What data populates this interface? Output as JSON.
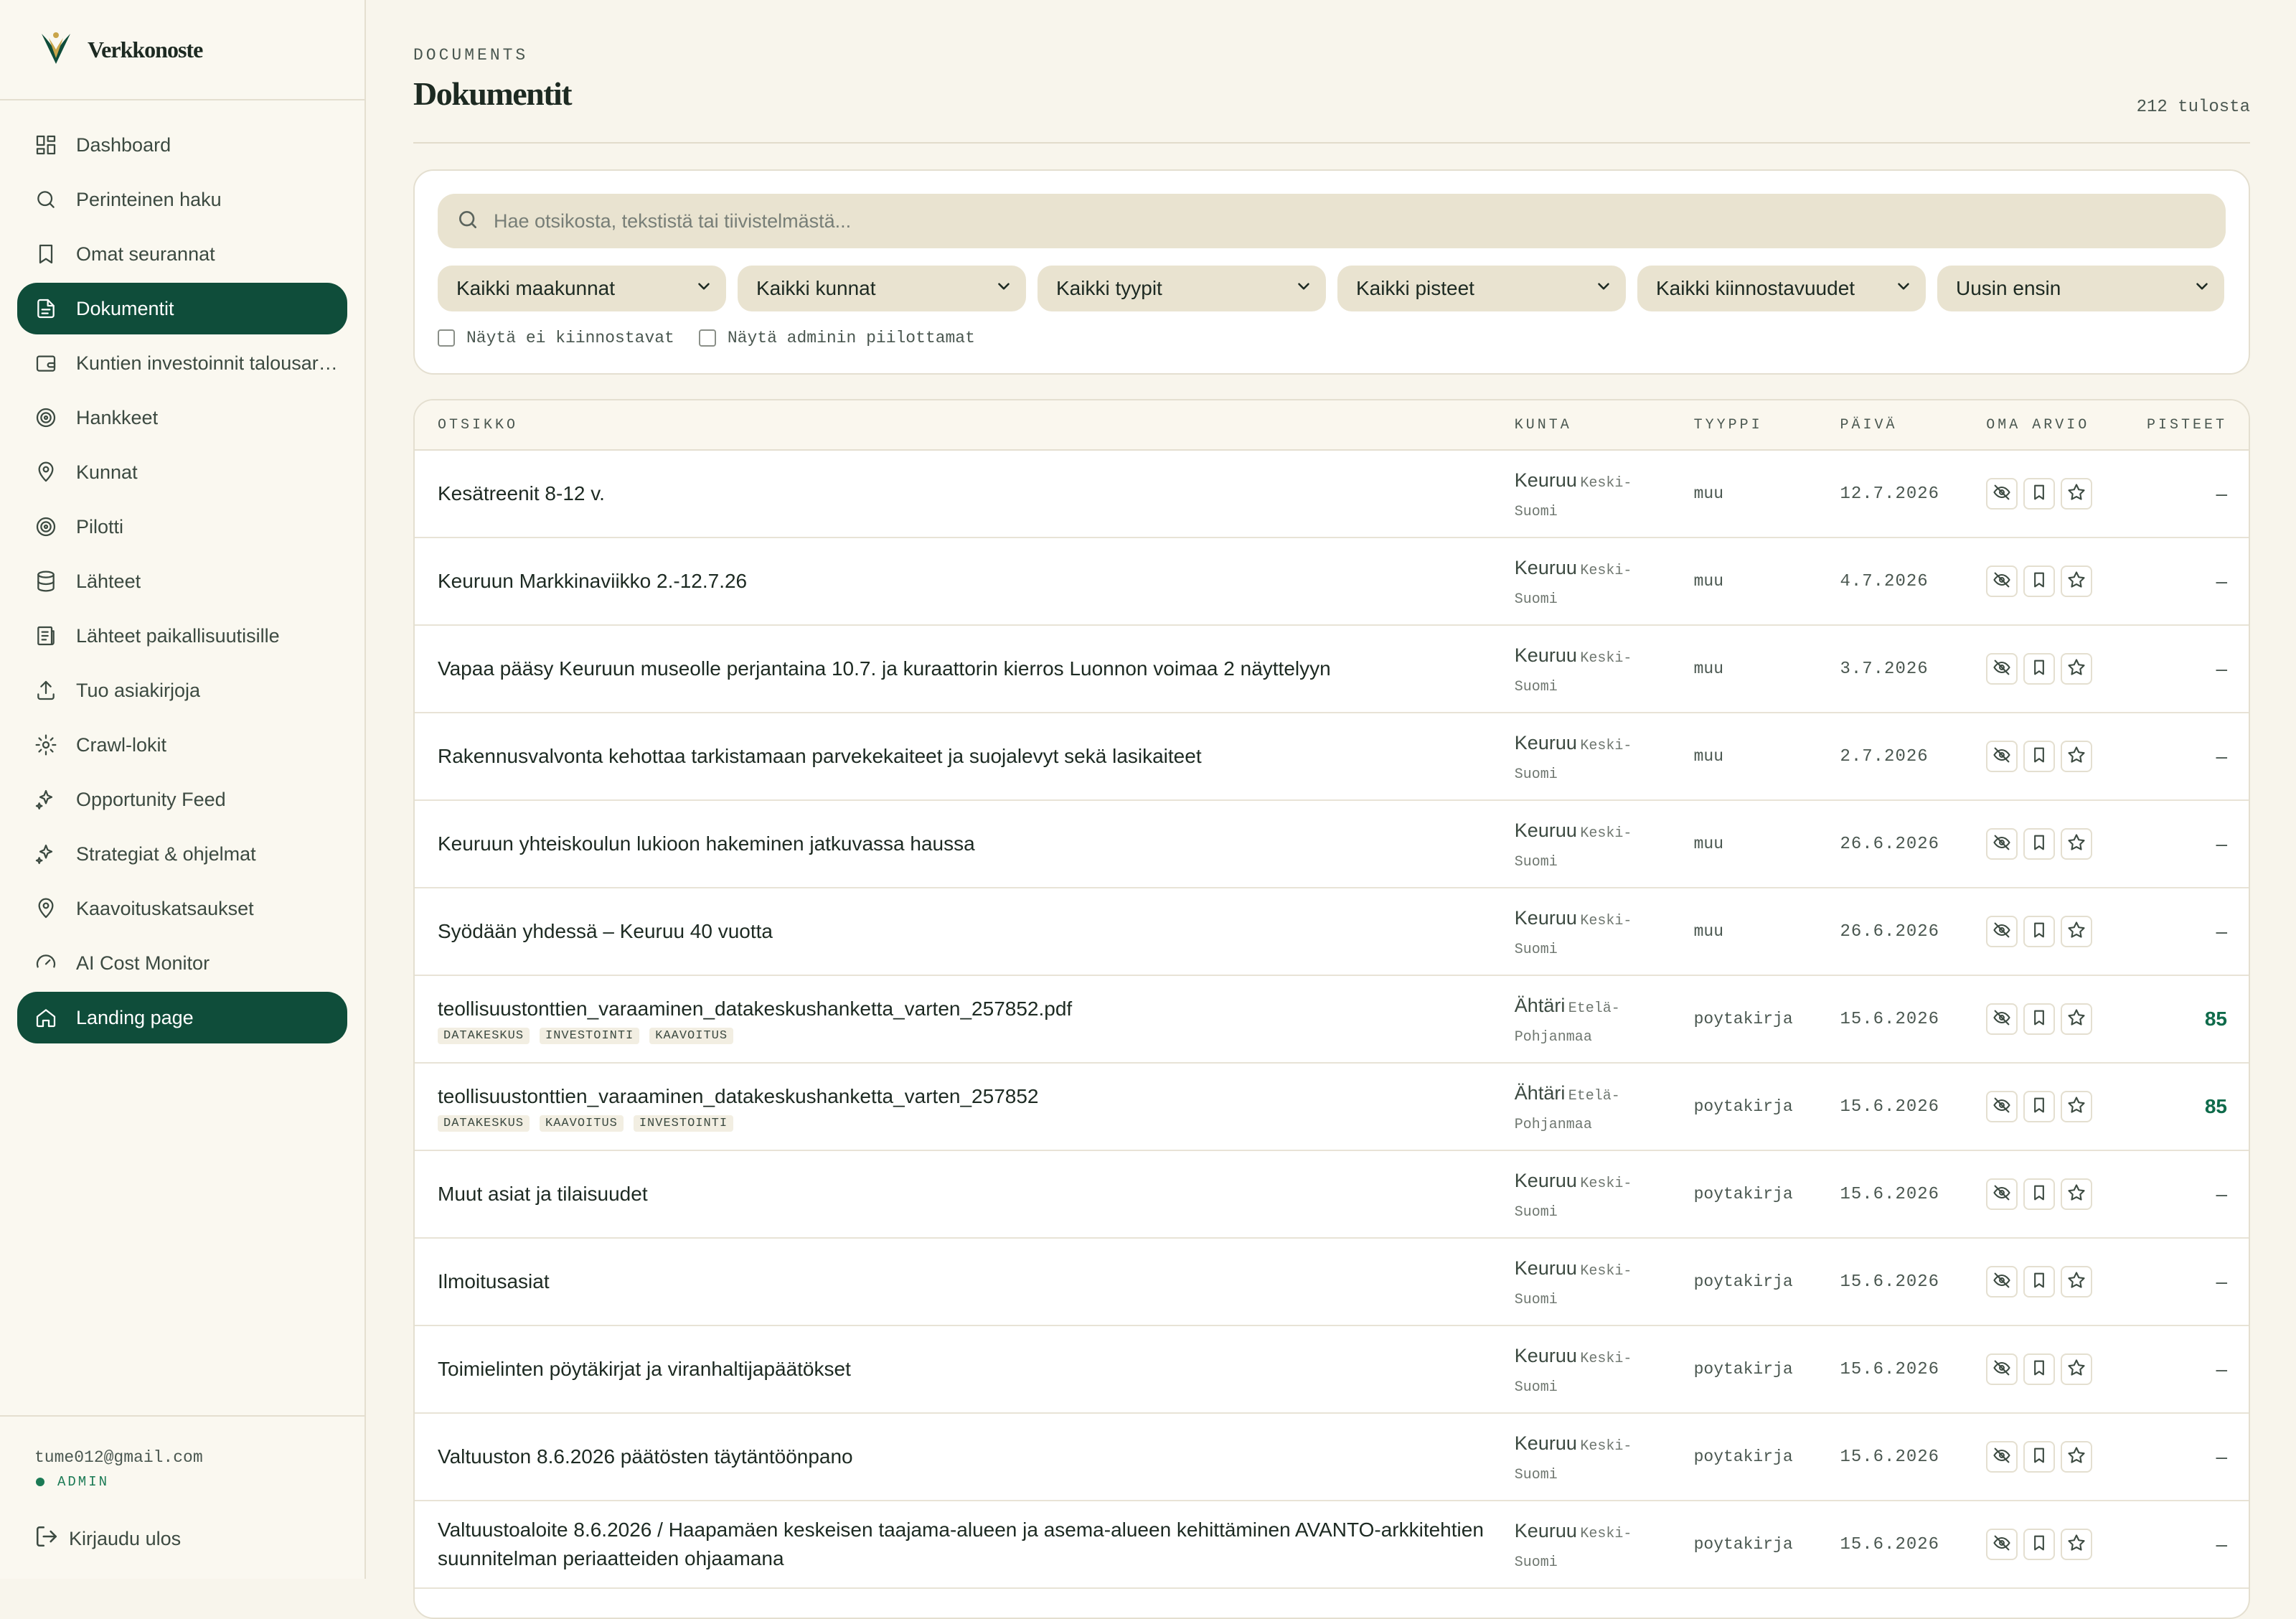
{
  "brand": {
    "name": "Verkkonoste"
  },
  "sidebar": {
    "items": [
      {
        "label": "Dashboard",
        "icon": "grid-icon",
        "active": false
      },
      {
        "label": "Perinteinen haku",
        "icon": "search-icon",
        "active": false
      },
      {
        "label": "Omat seurannat",
        "icon": "bookmark-icon",
        "active": false
      },
      {
        "label": "Dokumentit",
        "icon": "document-icon",
        "active": true
      },
      {
        "label": "Kuntien investoinnit talousarvioissa",
        "icon": "wallet-icon",
        "active": false
      },
      {
        "label": "Hankkeet",
        "icon": "target-icon",
        "active": false
      },
      {
        "label": "Kunnat",
        "icon": "map-pin-icon",
        "active": false
      },
      {
        "label": "Pilotti",
        "icon": "target-icon",
        "active": false
      },
      {
        "label": "Lähteet",
        "icon": "database-icon",
        "active": false
      },
      {
        "label": "Lähteet paikallisuutisille",
        "icon": "newspaper-icon",
        "active": false
      },
      {
        "label": "Tuo asiakirjoja",
        "icon": "upload-icon",
        "active": false
      },
      {
        "label": "Crawl-lokit",
        "icon": "gear-icon",
        "active": false
      },
      {
        "label": "Opportunity Feed",
        "icon": "sparkles-icon",
        "active": false
      },
      {
        "label": "Strategiat & ohjelmat",
        "icon": "sparkles-icon",
        "active": false
      },
      {
        "label": "Kaavoituskatsaukset",
        "icon": "map-pin-icon",
        "active": false
      },
      {
        "label": "AI Cost Monitor",
        "icon": "gauge-icon",
        "active": false
      },
      {
        "label": "Landing page",
        "icon": "home-icon",
        "active": true
      }
    ],
    "user_email": "tume012@gmail.com",
    "role": "ADMIN",
    "logout_label": "Kirjaudu ulos"
  },
  "header": {
    "eyebrow": "DOCUMENTS",
    "title": "Dokumentit",
    "result_count": "212 tulosta"
  },
  "filters": {
    "search_placeholder": "Hae otsikosta, tekstistä tai tiivistelmästä...",
    "selects": [
      "Kaikki maakunnat",
      "Kaikki kunnat",
      "Kaikki tyypit",
      "Kaikki pisteet",
      "Kaikki kiinnostavuudet",
      "Uusin ensin"
    ],
    "checkboxes": [
      "Näytä ei kiinnostavat",
      "Näytä adminin piilottamat"
    ]
  },
  "table": {
    "headers": {
      "title": "OTSIKKO",
      "kunta": "KUNTA",
      "type": "TYYPPI",
      "date": "PÄIVÄ",
      "arvio": "OMA ARVIO",
      "score": "PISTEET"
    },
    "rows": [
      {
        "title": "Kesätreenit 8-12 v.",
        "tags": [],
        "kunta": "Keuruu",
        "region_line1": "Keski-",
        "region_line2": "Suomi",
        "type": "muu",
        "date": "12.7.2026",
        "score": "–"
      },
      {
        "title": "Keuruun Markkinaviikko 2.-12.7.26",
        "tags": [],
        "kunta": "Keuruu",
        "region_line1": "Keski-",
        "region_line2": "Suomi",
        "type": "muu",
        "date": "4.7.2026",
        "score": "–"
      },
      {
        "title": "Vapaa pääsy Keuruun museolle perjantaina 10.7. ja kuraattorin kierros Luonnon voimaa 2 näyttelyyn",
        "tags": [],
        "kunta": "Keuruu",
        "region_line1": "Keski-",
        "region_line2": "Suomi",
        "type": "muu",
        "date": "3.7.2026",
        "score": "–"
      },
      {
        "title": "Rakennusvalvonta kehottaa tarkistamaan parvekekaiteet ja suojalevyt sekä lasikaiteet",
        "tags": [],
        "kunta": "Keuruu",
        "region_line1": "Keski-",
        "region_line2": "Suomi",
        "type": "muu",
        "date": "2.7.2026",
        "score": "–"
      },
      {
        "title": "Keuruun yhteiskoulun lukioon hakeminen jatkuvassa haussa",
        "tags": [],
        "kunta": "Keuruu",
        "region_line1": "Keski-",
        "region_line2": "Suomi",
        "type": "muu",
        "date": "26.6.2026",
        "score": "–"
      },
      {
        "title": "Syödään yhdessä – Keuruu 40 vuotta",
        "tags": [],
        "kunta": "Keuruu",
        "region_line1": "Keski-",
        "region_line2": "Suomi",
        "type": "muu",
        "date": "26.6.2026",
        "score": "–"
      },
      {
        "title": "teollisuustonttien_varaaminen_datakeskushanketta_varten_257852.pdf",
        "tags": [
          "DATAKESKUS",
          "INVESTOINTI",
          "KAAVOITUS"
        ],
        "kunta": "Ähtäri",
        "region_line1": "Etelä-",
        "region_line2": "Pohjanmaa",
        "type": "poytakirja",
        "date": "15.6.2026",
        "score": "85"
      },
      {
        "title": "teollisuustonttien_varaaminen_datakeskushanketta_varten_257852",
        "tags": [
          "DATAKESKUS",
          "KAAVOITUS",
          "INVESTOINTI"
        ],
        "kunta": "Ähtäri",
        "region_line1": "Etelä-",
        "region_line2": "Pohjanmaa",
        "type": "poytakirja",
        "date": "15.6.2026",
        "score": "85"
      },
      {
        "title": "Muut asiat ja tilaisuudet",
        "tags": [],
        "kunta": "Keuruu",
        "region_line1": "Keski-",
        "region_line2": "Suomi",
        "type": "poytakirja",
        "date": "15.6.2026",
        "score": "–"
      },
      {
        "title": "Ilmoitusasiat",
        "tags": [],
        "kunta": "Keuruu",
        "region_line1": "Keski-",
        "region_line2": "Suomi",
        "type": "poytakirja",
        "date": "15.6.2026",
        "score": "–"
      },
      {
        "title": "Toimielinten pöytäkirjat ja viranhaltijapäätökset",
        "tags": [],
        "kunta": "Keuruu",
        "region_line1": "Keski-",
        "region_line2": "Suomi",
        "type": "poytakirja",
        "date": "15.6.2026",
        "score": "–"
      },
      {
        "title": "Valtuuston 8.6.2026 päätösten täytäntöönpano",
        "tags": [],
        "kunta": "Keuruu",
        "region_line1": "Keski-",
        "region_line2": "Suomi",
        "type": "poytakirja",
        "date": "15.6.2026",
        "score": "–"
      },
      {
        "title": "Valtuustoaloite 8.6.2026 / Haapamäen keskeisen taajama-alueen ja asema-alueen kehittäminen AVANTO-arkkitehtien suunnitelman periaatteiden ohjaamana",
        "tags": [],
        "kunta": "Keuruu",
        "region_line1": "Keski-",
        "region_line2": "Suomi",
        "type": "poytakirja",
        "date": "15.6.2026",
        "score": "–"
      }
    ]
  },
  "colors": {
    "accent": "#0f4d3a",
    "score_high": "#0f6b4b",
    "background": "#f8f5ec"
  }
}
